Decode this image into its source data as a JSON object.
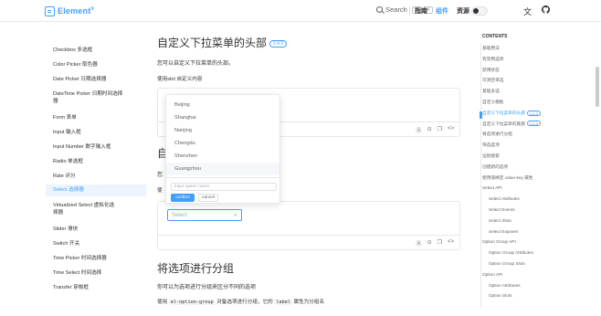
{
  "header": {
    "logo": "Element",
    "logo_mark": "®",
    "search_label": "Search",
    "search_keys": [
      "⌘",
      "K"
    ],
    "nav": [
      "指南",
      "组件",
      "资源"
    ],
    "nav_active": 1,
    "icons": [
      "translate-icon",
      "github-icon",
      "theme-toggle",
      "search-icon"
    ]
  },
  "sidebar": {
    "items": [
      "Checkbox 多选框",
      "Color Picker 取色器",
      "Date Picker 日期选择器",
      "DateTime Picker 日期时间选择器",
      "Form 表单",
      "Input 输入框",
      "Input Number 数字输入框",
      "Radio 单选框",
      "Rate 评分",
      "Select 选择器",
      "Virtualized Select 虚拟化选择器",
      "Slider 滑块",
      "Switch 开关",
      "Time Picker 时间选择器",
      "Time Select 时间选择",
      "Transfer 穿梭框"
    ],
    "active_index": 9
  },
  "main": {
    "section1_title": "自定义下拉菜单的头部",
    "section1_badge": "2.4.3",
    "section1_desc": "您可以自定义下拉菜单的头部。",
    "section1_slot": "使用slot 自定义内容",
    "section2_title_fragment": "自",
    "section2_desc_fragment": "您",
    "section2_slot_fragment": "使",
    "select_placeholder": "Select",
    "section3_title": "将选项进行分组",
    "section3_desc": "你可以为选项进行分组来区分不同的选项",
    "section3_code_prefix": "使用",
    "section3_code1": "el-option-group",
    "section3_code_mid": "对备选项进行分组，它的",
    "section3_code2": "label",
    "section3_code_suffix": "属性为分组名"
  },
  "dropdown": {
    "options": [
      "Beijing",
      "Shanghai",
      "Nanjing",
      "Chengdu",
      "Shenzhen",
      "Guangzhou"
    ],
    "hover_index": 5,
    "input_placeholder": "input option name",
    "confirm_label": "confirm",
    "cancel_label": "cancel"
  },
  "toc": {
    "title": "CONTENTS",
    "items": [
      {
        "label": "基础用法",
        "sub": false
      },
      {
        "label": "有禁用选项",
        "sub": false
      },
      {
        "label": "禁用状态",
        "sub": false
      },
      {
        "label": "可清空单选",
        "sub": false
      },
      {
        "label": "基础多选",
        "sub": false
      },
      {
        "label": "自定义模板",
        "sub": false
      },
      {
        "label": "自定义下拉菜单的头部",
        "sub": false,
        "badge": "2.4.3",
        "active": true
      },
      {
        "label": "自定义下拉菜单的底部",
        "sub": false,
        "badge": "2.4.3"
      },
      {
        "label": "将选项进行分组",
        "sub": false
      },
      {
        "label": "筛选选项",
        "sub": false
      },
      {
        "label": "远程搜索",
        "sub": false
      },
      {
        "label": "创建新的选项",
        "sub": false
      },
      {
        "label": "使用值绑定 value-key 属性",
        "sub": false
      },
      {
        "label": "Select API",
        "sub": false
      },
      {
        "label": "Select Attributes",
        "sub": true
      },
      {
        "label": "Select Events",
        "sub": true
      },
      {
        "label": "Select Slots",
        "sub": true
      },
      {
        "label": "Select Exposes",
        "sub": true
      },
      {
        "label": "Option Group API",
        "sub": false
      },
      {
        "label": "Option Group Attributes",
        "sub": true
      },
      {
        "label": "Option Group Slots",
        "sub": true
      },
      {
        "label": "Option API",
        "sub": false
      },
      {
        "label": "Option Attributes",
        "sub": true
      },
      {
        "label": "Option Slots",
        "sub": true
      }
    ]
  },
  "colors": {
    "accent": "#409eff",
    "text": "#303133",
    "border": "#e4e7ed"
  }
}
